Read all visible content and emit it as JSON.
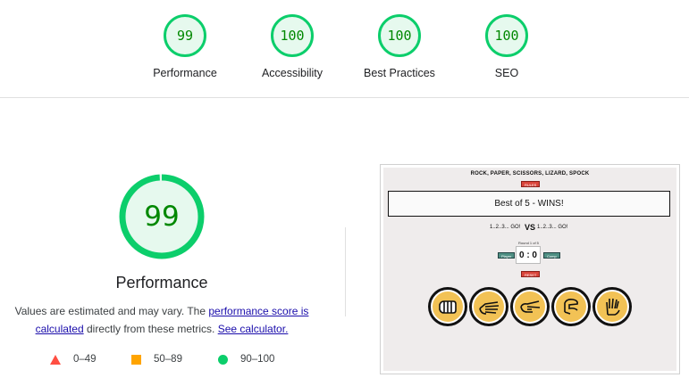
{
  "summary": {
    "categories": [
      {
        "score": "99",
        "label": "Performance"
      },
      {
        "score": "100",
        "label": "Accessibility"
      },
      {
        "score": "100",
        "label": "Best Practices"
      },
      {
        "score": "100",
        "label": "SEO"
      }
    ]
  },
  "performance": {
    "score": "99",
    "score_fraction": 0.99,
    "title": "Performance",
    "desc_prefix": "Values are estimated and may vary. The ",
    "link_score_calc": "performance score is calculated",
    "desc_middle": " directly from these metrics. ",
    "link_calculator": "See calculator.",
    "legend": {
      "fail": "0–49",
      "average": "50–89",
      "pass": "90–100"
    },
    "colors": {
      "pass": "#0cce6b",
      "average": "#ffa400",
      "fail": "#ff4e42",
      "score_text": "#008800"
    }
  },
  "screenshot": {
    "game_title": "ROCK, PAPER, SCISSORS, LIZARD, SPOCK",
    "rules_btn": "RULES",
    "banner": "Best of 5 - WINS!",
    "player_count": "1..2..3... GO!",
    "vs": "VS",
    "computer_count": "1..2..3... GO!",
    "round_label": "Round 1 of 5",
    "score": "0 : 0",
    "player_tag": "Player",
    "computer_tag": "Comp",
    "reset_btn": "RESET",
    "hands": [
      "rock-hand-icon",
      "paper-hand-icon",
      "scissors-hand-icon",
      "lizard-hand-icon",
      "spock-hand-icon"
    ]
  }
}
